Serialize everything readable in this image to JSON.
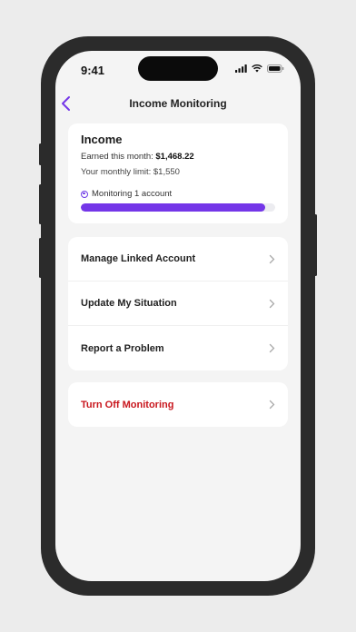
{
  "status_bar": {
    "time": "9:41"
  },
  "nav": {
    "title": "Income Monitoring"
  },
  "income": {
    "title": "Income",
    "earned_label": "Earned this month:",
    "earned_value": "$1,468.22",
    "limit_label": "Your monthly limit: $1,550",
    "monitoring_text": "Monitoring 1 account",
    "progress_fraction": 0.947
  },
  "menu": {
    "items": [
      {
        "label": "Manage Linked Account"
      },
      {
        "label": "Update My Situation"
      },
      {
        "label": "Report a Problem"
      }
    ]
  },
  "danger": {
    "label": "Turn Off Monitoring"
  },
  "colors": {
    "accent": "#7436e8",
    "danger": "#c8161d"
  }
}
